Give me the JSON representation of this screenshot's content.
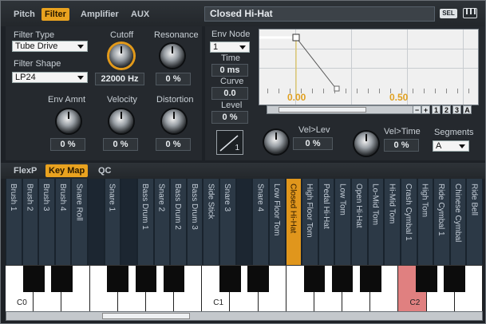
{
  "tabs": {
    "pitch": "Pitch",
    "filter": "Filter",
    "amplifier": "Amplifier",
    "aux": "AUX"
  },
  "preset": "Closed Hi-Hat",
  "sel_label": "SEL",
  "filter": {
    "type_label": "Filter Type",
    "type_value": "Tube Drive",
    "shape_label": "Filter Shape",
    "shape_value": "LP24",
    "cutoff_label": "Cutoff",
    "cutoff_value": "22000 Hz",
    "resonance_label": "Resonance",
    "resonance_value": "0 %",
    "env_amnt_label": "Env Amnt",
    "env_amnt_value": "0 %",
    "velocity_label": "Velocity",
    "velocity_value": "0 %",
    "distortion_label": "Distortion",
    "distortion_value": "0 %"
  },
  "env": {
    "node_label": "Env Node",
    "node_value": "1",
    "time_label": "Time",
    "time_value": "0 ms",
    "curve_label": "Curve",
    "curve_value": "0.0",
    "level_label": "Level",
    "level_value": "0 %",
    "graph_label_left": "0.00",
    "graph_label_right": "0.50",
    "vel_lev_label": "Vel>Lev",
    "vel_lev_value": "0 %",
    "vel_time_label": "Vel>Time",
    "vel_time_value": "0 %",
    "segments_label": "Segments",
    "segments_value": "A",
    "curve_index": "1",
    "btn_minus": "−",
    "btn_plus": "+",
    "btn_1": "1",
    "btn_2": "2",
    "btn_3": "3",
    "btn_a": "A"
  },
  "lower_tabs": {
    "flexp": "FlexP",
    "keymap": "Key Map",
    "qc": "QC"
  },
  "keymap_lanes": [
    "Brush 1",
    "Brush 2",
    "Brush 3",
    "Brush 4",
    "Snare Roll",
    "",
    "Snare 1",
    "",
    "Bass Drum 1",
    "Snare 2",
    "Bass Drum 2",
    "Bass Drum 3",
    "Side Stick",
    "Snare 3",
    "",
    "Snare 4",
    "Low Floor Tom",
    "Closed Hi-Hat",
    "High Floor Tom",
    "Pedal Hi-Hat",
    "Low Tom",
    "Open Hi-Hat",
    "Lo-Mid Tom",
    "Hi-Mid Tom",
    "Crash Cymbal 1",
    "High Tom",
    "Ride Cymbal 1",
    "Chinese Cymbal",
    "Ride Bell"
  ],
  "keyboard_labels": {
    "c0": "C0",
    "c1": "C1",
    "c2": "C2"
  },
  "colors": {
    "accent": "#e39a1a",
    "selected_lane": "#e0961c",
    "highlight_key": "#e08080",
    "panel": "#25292e"
  }
}
